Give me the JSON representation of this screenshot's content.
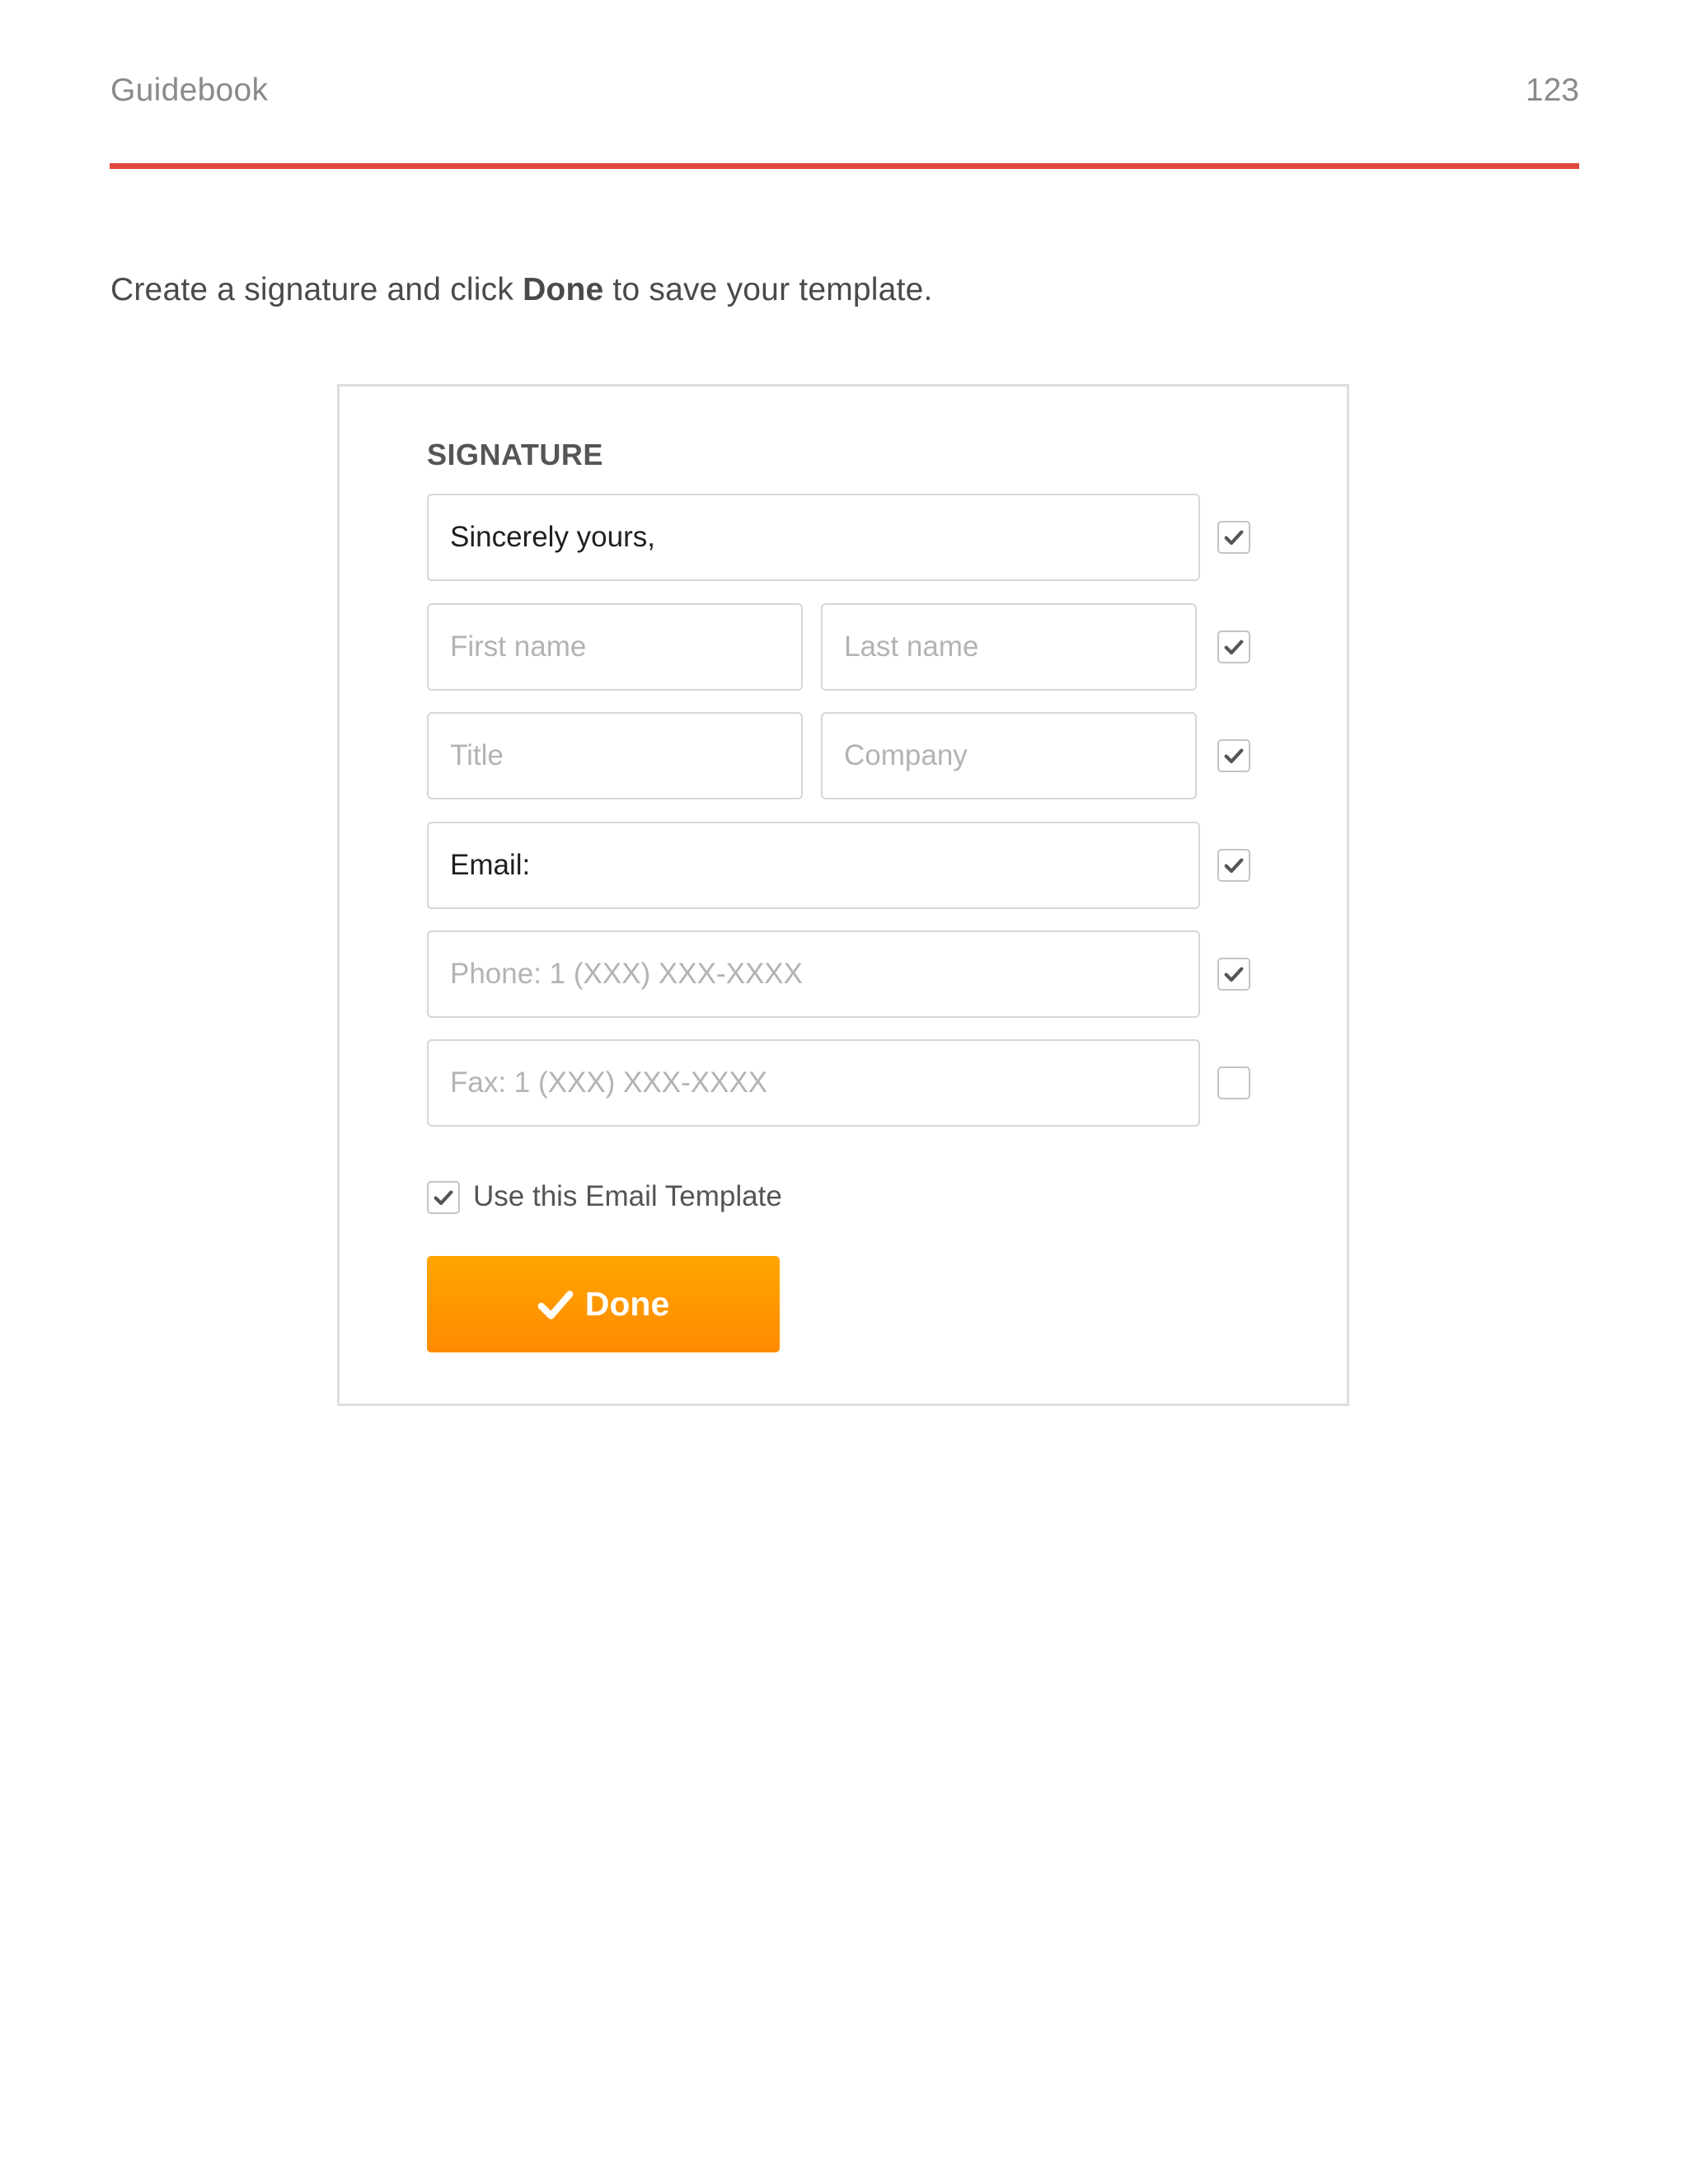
{
  "header": {
    "title": "Guidebook",
    "page_number": "123",
    "accent_color": "#e1483d"
  },
  "intro": {
    "before": "Create a signature and click ",
    "bold": "Done",
    "after": " to save your template."
  },
  "signature": {
    "title": "SIGNATURE",
    "rows": [
      {
        "fields": [
          {
            "value": "Sincerely yours,",
            "placeholder": ""
          }
        ],
        "checked": true
      },
      {
        "fields": [
          {
            "value": "",
            "placeholder": "First name"
          },
          {
            "value": "",
            "placeholder": "Last name"
          }
        ],
        "checked": true
      },
      {
        "fields": [
          {
            "value": "",
            "placeholder": "Title"
          },
          {
            "value": "",
            "placeholder": "Company"
          }
        ],
        "checked": true
      },
      {
        "fields": [
          {
            "value": "Email:",
            "placeholder": ""
          }
        ],
        "checked": true
      },
      {
        "fields": [
          {
            "value": "",
            "placeholder": "Phone: 1 (XXX) XXX-XXXX"
          }
        ],
        "checked": true
      },
      {
        "fields": [
          {
            "value": "",
            "placeholder": "Fax: 1 (XXX) XXX-XXXX"
          }
        ],
        "checked": false
      }
    ],
    "use_template": {
      "label": "Use this Email Template",
      "checked": true
    },
    "done_button": {
      "label": "Done",
      "icon": "check-icon",
      "color": "#ff9800"
    }
  }
}
